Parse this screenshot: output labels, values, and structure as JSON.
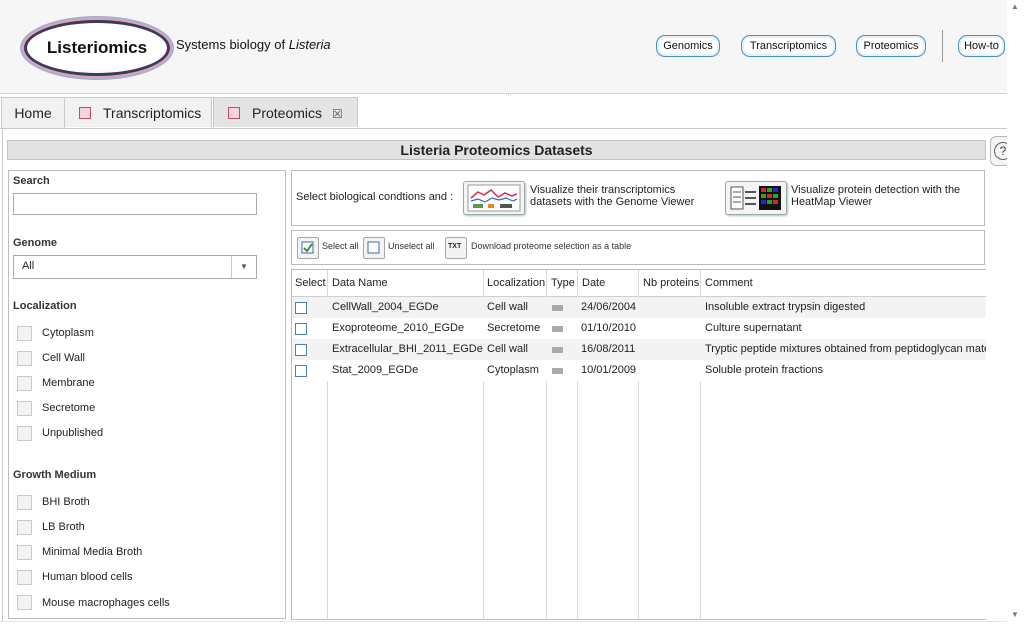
{
  "header": {
    "logo_text": "Listeriomics",
    "tagline_prefix": "Systems biology of ",
    "tagline_species": "Listeria",
    "nav": [
      "Genomics",
      "Transcriptomics",
      "Proteomics",
      "How-to"
    ]
  },
  "tabs": [
    {
      "label": "Home",
      "icon": false,
      "closable": false,
      "active": false
    },
    {
      "label": "Transcriptomics",
      "icon": true,
      "closable": false,
      "active": false
    },
    {
      "label": "Proteomics",
      "icon": true,
      "closable": true,
      "active": true
    }
  ],
  "page_title": "Listeria Proteomics Datasets",
  "help_label": "?",
  "filters": {
    "search_label": "Search",
    "search_value": "",
    "genome_label": "Genome",
    "genome_value": "All",
    "localization_label": "Localization",
    "localization_items": [
      "Cytoplasm",
      "Cell Wall",
      "Membrane",
      "Secretome",
      "Unpublished"
    ],
    "growth_label": "Growth Medium",
    "growth_items": [
      "BHI Broth",
      "LB Broth",
      "Minimal Media Broth",
      "Human blood cells",
      "Mouse macrophages cells"
    ]
  },
  "actions": {
    "prompt": "Select biological condtions and :",
    "genome_viewer": [
      "Visualize their transcriptomics",
      "datasets with the Genome Viewer"
    ],
    "heatmap_viewer": [
      "Visualize protein detection with the",
      "HeatMap Viewer"
    ]
  },
  "toolbar": {
    "select_all": "Select all",
    "unselect_all": "Unselect all",
    "download_icon_text": "TXT",
    "download": "Download proteome selection as a table"
  },
  "table": {
    "columns": [
      "Select",
      "Data Name",
      "Localization",
      "Type",
      "Date",
      "Nb proteins",
      "Comment"
    ],
    "rows": [
      {
        "name": "CellWall_2004_EGDe",
        "localization": "Cell wall",
        "date": "24/06/2004",
        "nb": "",
        "comment": "Insoluble extract trypsin digested"
      },
      {
        "name": "Exoproteome_2010_EGDe",
        "localization": "Secretome",
        "date": "01/10/2010",
        "nb": "",
        "comment": "Culture supernatant"
      },
      {
        "name": "Extracellular_BHI_2011_EGDe",
        "localization": "Cell wall",
        "date": "16/08/2011",
        "nb": "",
        "comment": "Tryptic peptide mixtures obtained from peptidoglycan mater"
      },
      {
        "name": "Stat_2009_EGDe",
        "localization": "Cytoplasm",
        "date": "10/01/2009",
        "nb": "",
        "comment": "Soluble protein fractions"
      }
    ]
  },
  "colors": {
    "accent_border": "#4a8fc0",
    "checkbox_check": "#2a8a2a"
  }
}
